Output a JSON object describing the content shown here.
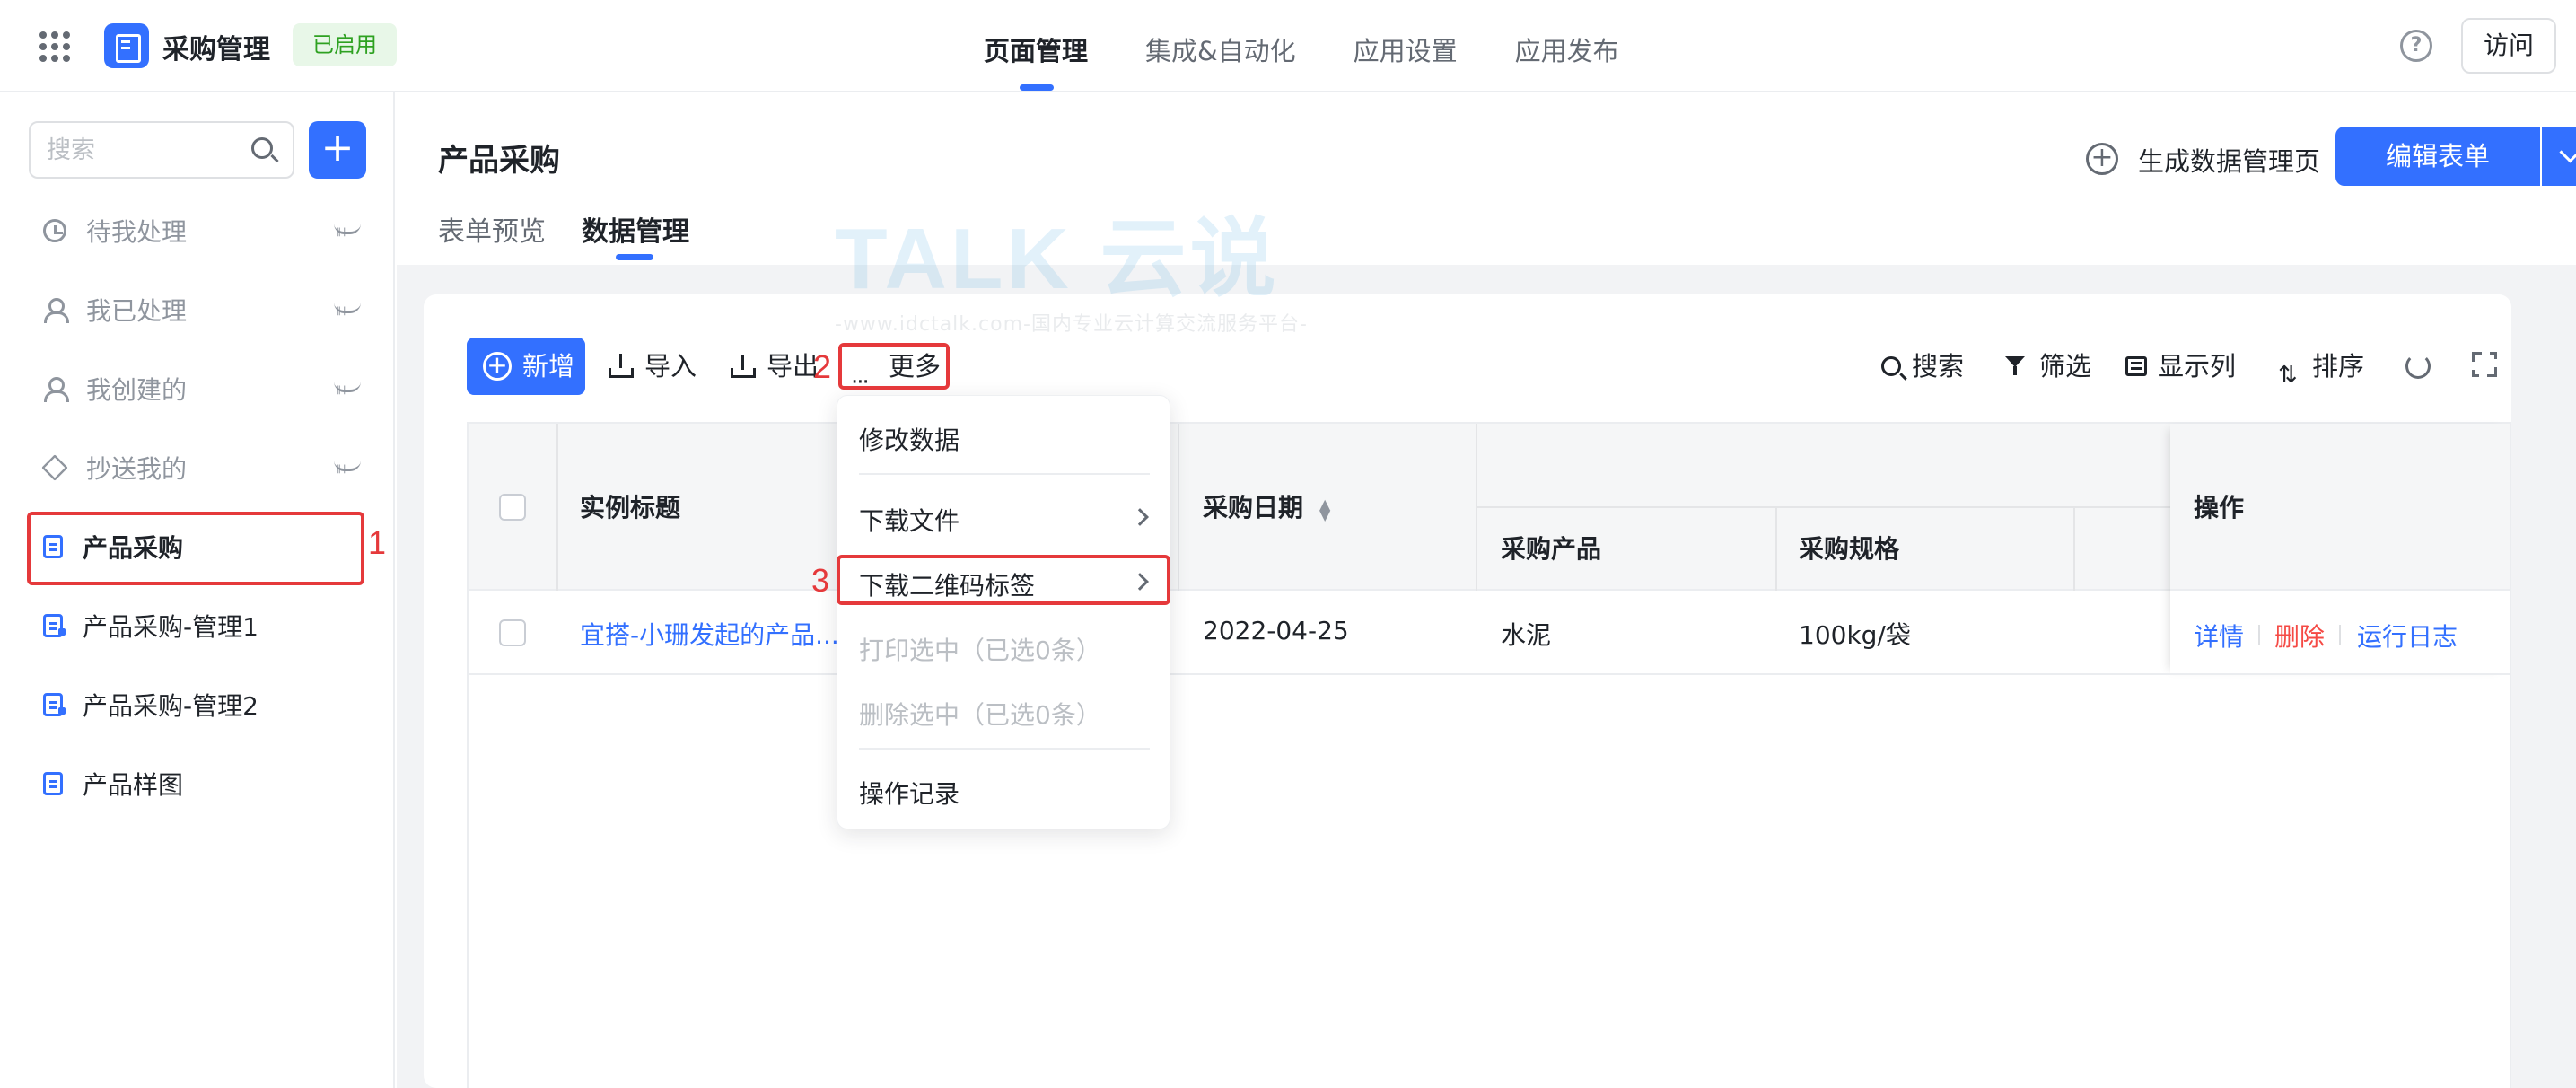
{
  "app": {
    "title": "采购管理",
    "status": "已启用"
  },
  "nav": {
    "items": [
      "页面管理",
      "集成&自动化",
      "应用设置",
      "应用发布"
    ],
    "active": "页面管理",
    "help": "?",
    "visit_label": "访问"
  },
  "sidebar": {
    "search_placeholder": "搜索",
    "add_label": "+",
    "items": [
      {
        "label": "待我处理",
        "icon": "clock-icon"
      },
      {
        "label": "我已处理",
        "icon": "user-check-icon"
      },
      {
        "label": "我创建的",
        "icon": "user-icon"
      },
      {
        "label": "抄送我的",
        "icon": "send-icon"
      },
      {
        "label": "产品采购",
        "icon": "form-icon"
      },
      {
        "label": "产品采购-管理1",
        "icon": "report-icon"
      },
      {
        "label": "产品采购-管理2",
        "icon": "report-icon"
      },
      {
        "label": "产品样图",
        "icon": "form-icon"
      }
    ]
  },
  "header": {
    "page_title": "产品采购",
    "tabs": [
      "表单预览",
      "数据管理"
    ],
    "active_tab": "数据管理",
    "generate_label": "生成数据管理页",
    "edit_form_label": "编辑表单"
  },
  "toolbar": {
    "add_label": "新增",
    "import_label": "导入",
    "export_label": "导出",
    "more_label": "更多",
    "search_label": "搜索",
    "filter_label": "筛选",
    "columns_label": "显示列",
    "sort_label": "排序"
  },
  "menu": {
    "items": [
      {
        "label": "修改数据",
        "disabled": false
      },
      {
        "label": "下载文件",
        "disabled": false,
        "submenu": true
      },
      {
        "label": "下载二维码标签",
        "disabled": false,
        "submenu": true
      },
      {
        "label": "打印选中（已选0条）",
        "disabled": true
      },
      {
        "label": "删除选中（已选0条）",
        "disabled": true
      },
      {
        "label": "操作记录",
        "disabled": false
      }
    ]
  },
  "table": {
    "columns": {
      "title": "实例标题",
      "date": "采购日期",
      "product": "采购产品",
      "spec": "采购规格",
      "ops": "操作"
    },
    "rows": [
      {
        "title": "宜搭-小珊发起的产品...",
        "date": "2022-04-25",
        "product": "水泥",
        "spec": "100kg/袋",
        "ops": [
          "详情",
          "删除",
          "运行日志"
        ]
      }
    ]
  },
  "annotations": [
    "1",
    "2",
    "3"
  ],
  "watermark": {
    "logo": "TALK 云说",
    "subtitle": "-www.idctalk.com-国内专业云计算交流服务平台-"
  },
  "colors": {
    "accent": "#3370ff",
    "annotation": "#e5393b",
    "success": "#2ea121",
    "danger": "#f54a45"
  }
}
